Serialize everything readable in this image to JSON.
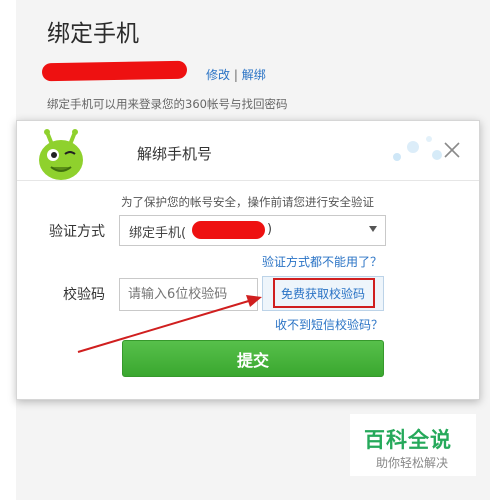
{
  "page": {
    "title": "绑定手机",
    "actions": {
      "modify": "修改",
      "separator": "|",
      "unbind": "解绑"
    },
    "description": "绑定手机可以用来登录您的360帐号与找回密码"
  },
  "dialog": {
    "title": "解绑手机号",
    "notice": "为了保护您的帐号安全，操作前请您进行安全验证",
    "method_label": "验证方式",
    "method_value_prefix": "绑定手机(",
    "method_value_suffix": ")",
    "method_unavailable_link": "验证方式都不能用了？",
    "code_label": "校验码",
    "code_placeholder": "请输入6位校验码",
    "get_code_button": "免费获取校验码",
    "no_sms_link": "收不到短信校验码？",
    "submit_button": "提交"
  },
  "watermark": {
    "title": "百科全说",
    "subtitle": "助你轻松解决"
  },
  "colors": {
    "link": "#2a73c5",
    "submit_green": "#3aa72f",
    "redaction_red": "#ee1111",
    "annotation_red": "#d01f1f",
    "watermark_green": "#26a95b"
  },
  "icons": {
    "close": "close-icon",
    "mascot": "mascot-icon",
    "dropdown": "chevron-down-icon"
  }
}
